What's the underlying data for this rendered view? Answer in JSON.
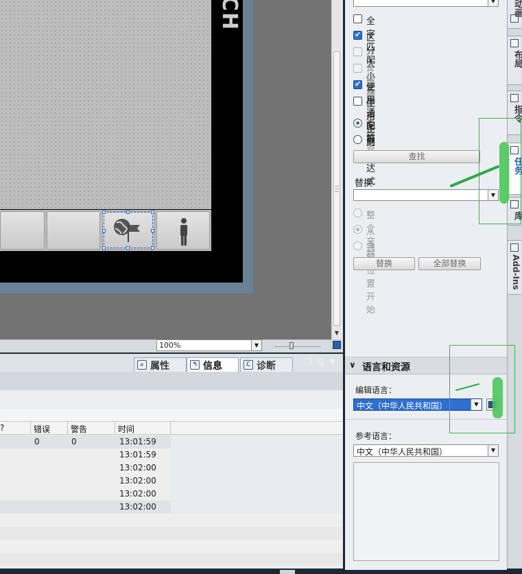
{
  "screen": {
    "brand_text": "CH"
  },
  "zoom": {
    "value": "100%",
    "slider_level": 0.35
  },
  "inspector": {
    "tabs": [
      {
        "label": "属性",
        "active": false
      },
      {
        "label": "信息",
        "active": true
      },
      {
        "label": "诊断",
        "active": false
      }
    ],
    "table": {
      "columns": [
        "?",
        "错误",
        "警告",
        "时间"
      ],
      "rows": [
        {
          "errors": "0",
          "warnings": "0",
          "time": "13:01:59"
        },
        {
          "errors": "",
          "warnings": "",
          "time": "13:01:59"
        },
        {
          "errors": "",
          "warnings": "",
          "time": "13:02:00"
        },
        {
          "errors": "",
          "warnings": "",
          "time": "13:02:00"
        },
        {
          "errors": "",
          "warnings": "",
          "time": "13:02:00"
        },
        {
          "errors": "",
          "warnings": "",
          "time": "13:02:00"
        }
      ]
    }
  },
  "find_replace": {
    "options": [
      {
        "label": "全字匹配",
        "checked": false,
        "enabled": true
      },
      {
        "label": "区分大小写",
        "checked": true,
        "enabled": true
      },
      {
        "label": "在子结构中查找",
        "checked": false,
        "enabled": false
      },
      {
        "label": "在隐藏文本中查找",
        "checked": false,
        "enabled": false
      },
      {
        "label": "使用通配符",
        "checked": true,
        "enabled": true
      },
      {
        "label": "使用正则表达式",
        "checked": false,
        "enabled": true
      }
    ],
    "direction": [
      {
        "label": "向前",
        "selected": true
      },
      {
        "label": "向后",
        "selected": false
      }
    ],
    "find_button": "查找",
    "replace_label": "替换为：",
    "scope": [
      {
        "label": "整个文档",
        "selected": false
      },
      {
        "label": "从当前位置开始",
        "selected": true
      },
      {
        "label": "选择",
        "selected": false
      }
    ],
    "replace_button": "替换",
    "replace_all_button": "全部替换"
  },
  "language_panel": {
    "title": "语言和资源",
    "edit_language_label": "编辑语言：",
    "edit_language_value": "中文（中华人民共和国）",
    "reference_language_label": "参考语言：",
    "reference_language_value": "中文（中华人民共和国）"
  },
  "task_cards": [
    {
      "label": "动画",
      "icon": "animation-icon",
      "active": false
    },
    {
      "label": "布局",
      "icon": "layout-icon",
      "active": false
    },
    {
      "label": "指令",
      "icon": "instructions-icon",
      "active": false
    },
    {
      "label": "任务",
      "icon": "tasks-icon",
      "active": true
    },
    {
      "label": "库",
      "icon": "library-icon",
      "active": false
    },
    {
      "label": "Add-Ins",
      "icon": "addins-icon",
      "active": false
    }
  ],
  "colors": {
    "accent": "#2f6fd0",
    "annotation": "#39b34a",
    "divider": "#1b2633"
  }
}
